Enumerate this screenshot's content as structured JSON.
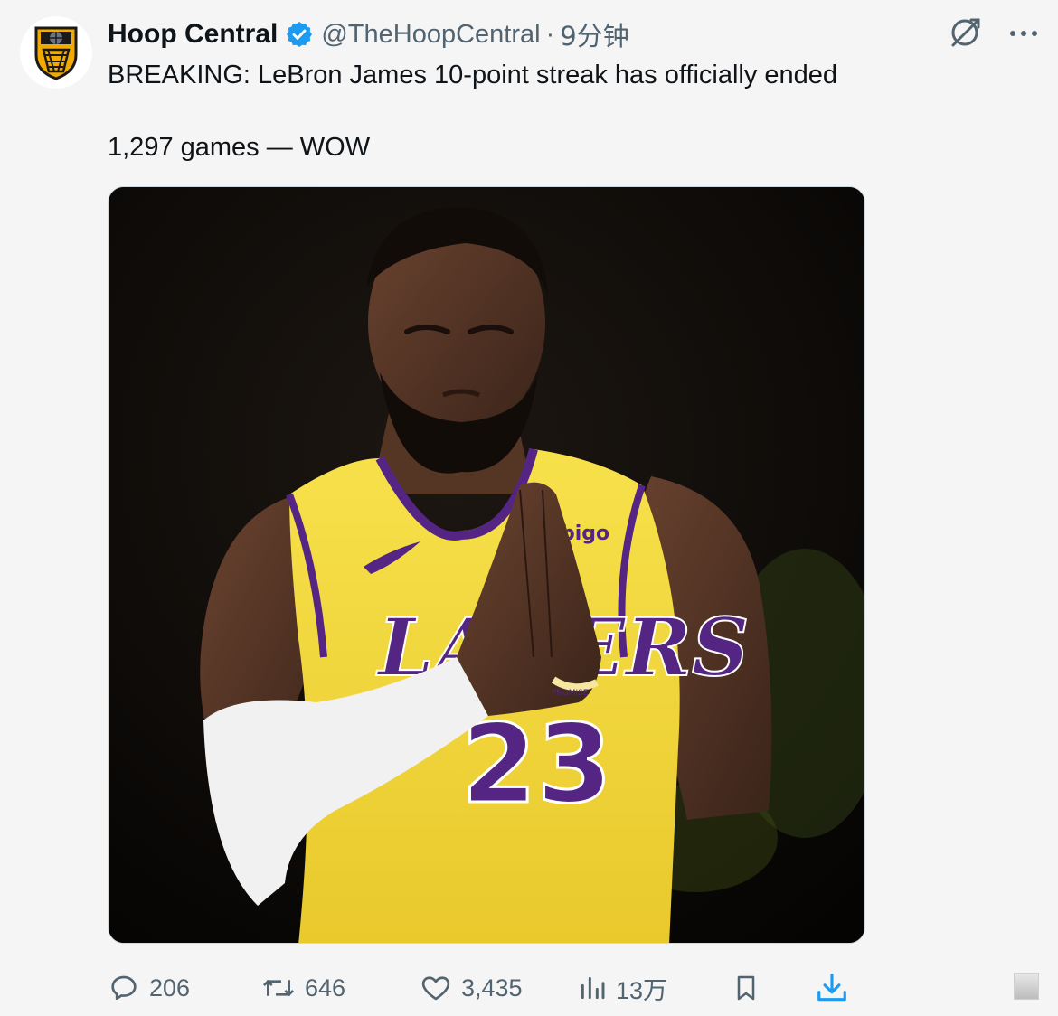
{
  "author": {
    "name": "Hoop Central",
    "handle": "@TheHoopCentral",
    "separator": "·",
    "time": "9分钟",
    "avatar_icon": "basketball-hoop-logo-icon",
    "verified_icon": "verified-badge-icon"
  },
  "tweet": {
    "line1": "BREAKING: LeBron James 10-point streak has officially ended",
    "line2": "1,297 games — WOW"
  },
  "header_actions": [
    {
      "icon": "grok-icon"
    },
    {
      "icon": "more-icon"
    }
  ],
  "media": {
    "type": "photo",
    "jersey_text": "LAKERS",
    "jersey_number": "23",
    "sponsor": "bigo",
    "wristband": "PROMISE"
  },
  "stats": {
    "replies": "206",
    "retweets": "646",
    "likes": "3,435",
    "views": "13万"
  },
  "colors": {
    "accent": "#1d9bf0",
    "muted": "#536471",
    "jersey_yellow": "#f5d93f",
    "jersey_purple": "#552583"
  }
}
